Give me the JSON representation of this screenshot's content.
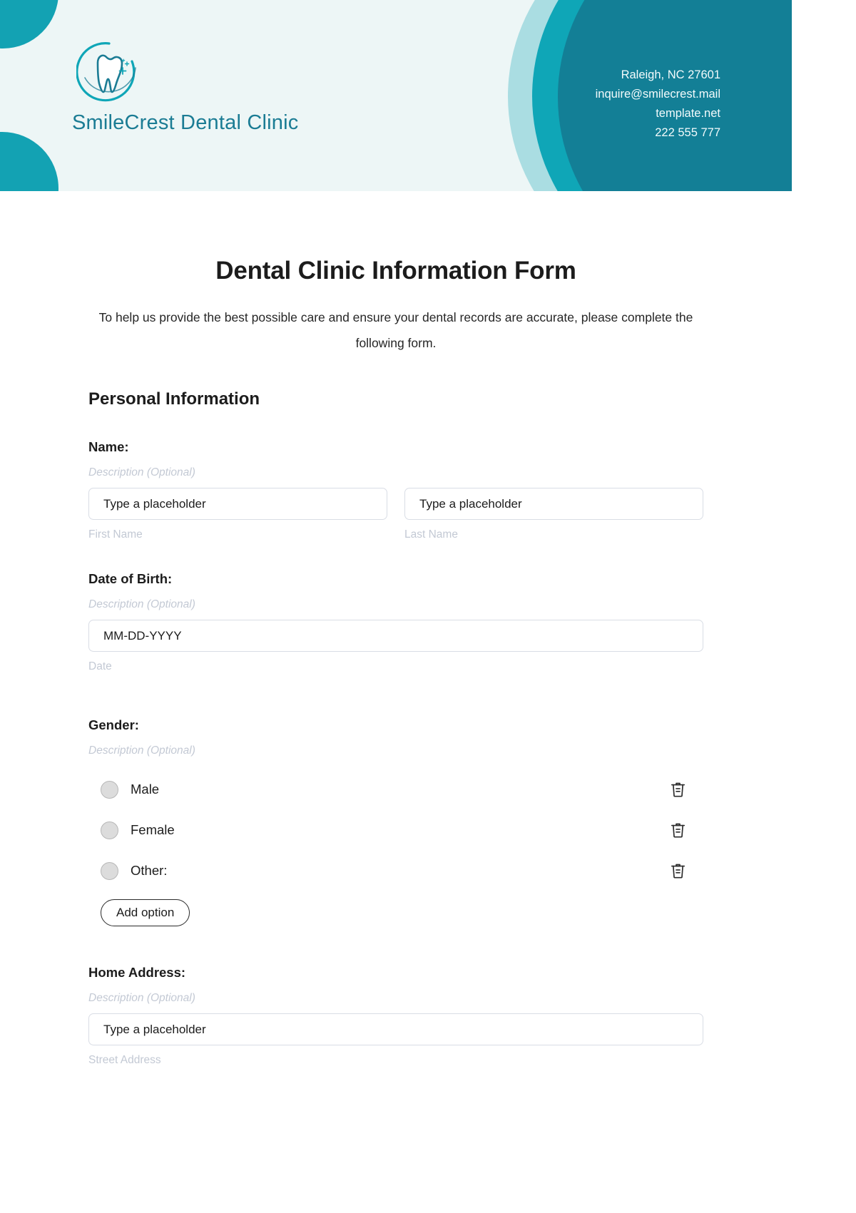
{
  "header": {
    "logo_icon": "tooth-in-circle-logo",
    "clinic_name": "SmileCrest Dental Clinic",
    "contact": {
      "address": "Raleigh, NC 27601",
      "email": "inquire@smilecrest.mail",
      "website": "template.net",
      "phone": "222 555 777"
    },
    "colors": {
      "background": "#edf6f6",
      "arc_light": "#aadde2",
      "arc_mid": "#0fa6b7",
      "arc_dark": "#137f96",
      "logo_text": "#1b7c94"
    }
  },
  "form": {
    "title": "Dental Clinic Information Form",
    "subtitle": "To help us provide the best possible care and ensure your dental records are accurate, please complete the following form.",
    "section_title": "Personal Information",
    "fields": {
      "name": {
        "label": "Name:",
        "description": "Description (Optional)",
        "first": {
          "value": "Type a placeholder",
          "sub_label": "First Name"
        },
        "last": {
          "value": "Type a placeholder",
          "sub_label": "Last Name"
        }
      },
      "dob": {
        "label": "Date of Birth:",
        "description": "Description (Optional)",
        "value": "MM-DD-YYYY",
        "sub_label": "Date"
      },
      "gender": {
        "label": "Gender:",
        "description": "Description (Optional)",
        "options": [
          {
            "label": "Male",
            "delete_icon": "trash-icon"
          },
          {
            "label": "Female",
            "delete_icon": "trash-icon"
          },
          {
            "label": "Other:",
            "delete_icon": "trash-icon"
          }
        ],
        "add_option_label": "Add option"
      },
      "address": {
        "label": "Home Address:",
        "description": "Description (Optional)",
        "value": "Type a placeholder",
        "sub_label": "Street Address"
      }
    }
  }
}
